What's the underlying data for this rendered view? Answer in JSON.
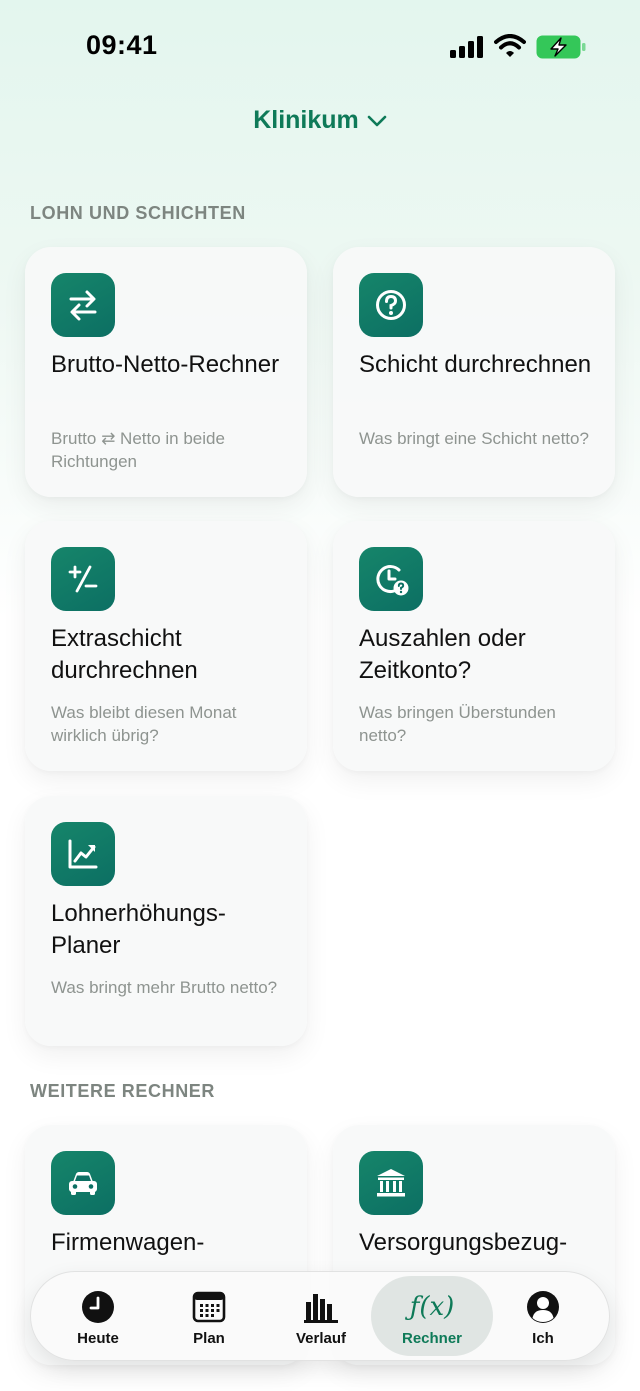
{
  "status": {
    "time": "09:41"
  },
  "header": {
    "location": "Klinikum"
  },
  "sections": [
    {
      "title": "LOHN UND SCHICHTEN"
    },
    {
      "title": "WEITERE RECHNER"
    }
  ],
  "cards": [
    {
      "icon": "swap-arrows-icon",
      "title": "Brutto-Netto-Rechner",
      "subtitle": "Brutto ⇄ Netto in beide Richtungen"
    },
    {
      "icon": "question-circle-icon",
      "title": "Schicht durchrechnen",
      "subtitle": "Was bringt eine Schicht netto?"
    },
    {
      "icon": "plus-minus-icon",
      "title": "Extraschicht durchrechnen",
      "subtitle": "Was bleibt diesen Monat wirklich übrig?"
    },
    {
      "icon": "clock-question-icon",
      "title": "Auszahlen oder Zeitkonto?",
      "subtitle": "Was bringen Überstunden netto?"
    },
    {
      "icon": "chart-trend-icon",
      "title": "Lohnerhöhungs-Planer",
      "subtitle": "Was bringt mehr Brutto netto?"
    },
    {
      "icon": "car-icon",
      "title": "Firmenwagen-",
      "subtitle": ""
    },
    {
      "icon": "bank-building-icon",
      "title": "Versorgungsbezug-",
      "subtitle": ""
    }
  ],
  "tabs": [
    {
      "icon": "clock-icon",
      "label": "Heute"
    },
    {
      "icon": "calendar-icon",
      "label": "Plan"
    },
    {
      "icon": "bar-chart-icon",
      "label": "Verlauf"
    },
    {
      "icon": "fx-icon",
      "glyph": "ƒ(x)",
      "label": "Rechner",
      "active": true
    },
    {
      "icon": "person-icon",
      "label": "Ich"
    }
  ],
  "colors": {
    "accent": "#0e7a58",
    "icon_bg": "#12806a",
    "muted": "#8e9490"
  }
}
